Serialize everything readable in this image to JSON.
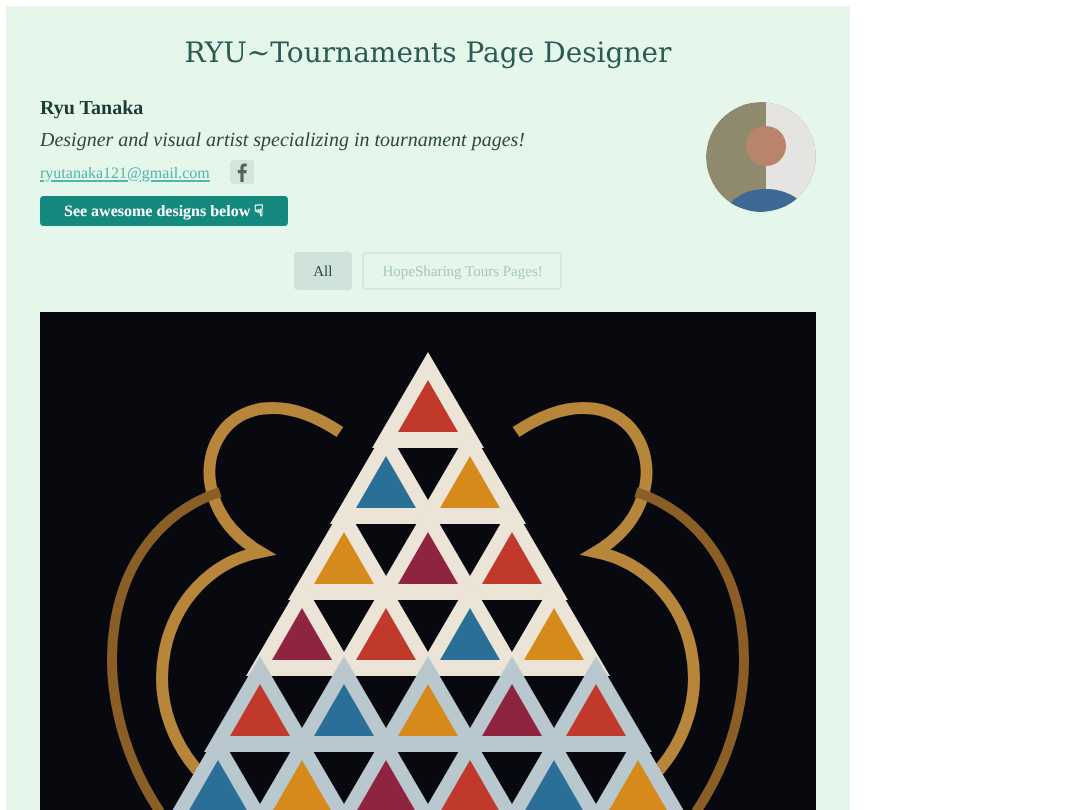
{
  "header": {
    "title": "RYU~Tournaments Page Designer"
  },
  "profile": {
    "name": "Ryu Tanaka",
    "bio": "Designer and visual artist specializing in tournament pages!",
    "email": "ryutanaka121@gmail.com",
    "button": "See awesome designs below ☟"
  },
  "filters": [
    {
      "label": "All",
      "selected": true
    },
    {
      "label": "HopeSharing Tours Pages!",
      "selected": false
    }
  ]
}
